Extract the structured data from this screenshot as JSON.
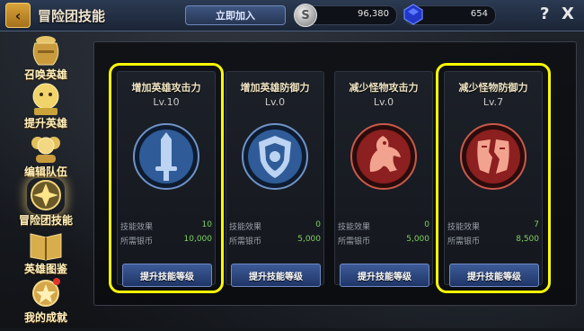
{
  "header": {
    "title": "冒险团技能",
    "back_icon": "back-icon",
    "join_label": "立即加入",
    "silver": "96,380",
    "gems": "654",
    "help": "?",
    "close": "X",
    "silver_icon_glyph": "S"
  },
  "sidebar": {
    "items": [
      {
        "label": "召唤英雄",
        "icon": "jar-icon"
      },
      {
        "label": "提升英雄",
        "icon": "levelup-icon"
      },
      {
        "label": "编辑队伍",
        "icon": "team-icon"
      },
      {
        "label": "冒险团技能",
        "icon": "skill-icon",
        "active": true
      },
      {
        "label": "英雄图鉴",
        "icon": "book-icon"
      },
      {
        "label": "我的成就",
        "icon": "medal-icon"
      }
    ]
  },
  "cards": [
    {
      "title": "增加英雄攻击力",
      "level": "Lv.10",
      "emblem": "sword-icon",
      "color": "#2f5c98",
      "effect_label": "技能效果",
      "effect": "10",
      "cost_label": "所需银币",
      "cost": "10,000",
      "button": "提升技能等级",
      "highlighted": true
    },
    {
      "title": "增加英雄防御力",
      "level": "Lv.0",
      "emblem": "shield-icon",
      "color": "#2f5c98",
      "effect_label": "技能效果",
      "effect": "0",
      "cost_label": "所需银币",
      "cost": "5,000",
      "button": "提升技能等级",
      "highlighted": false
    },
    {
      "title": "减少怪物攻击力",
      "level": "Lv.0",
      "emblem": "dragon-icon",
      "color": "#8c1f1f",
      "effect_label": "技能效果",
      "effect": "0",
      "cost_label": "所需银币",
      "cost": "5,000",
      "button": "提升技能等级",
      "highlighted": false
    },
    {
      "title": "减少怪物防御力",
      "level": "Lv.7",
      "emblem": "broken-shield-icon",
      "color": "#8c1f1f",
      "effect_label": "技能效果",
      "effect": "7",
      "cost_label": "所需银币",
      "cost": "8,500",
      "button": "提升技能等级",
      "highlighted": true
    }
  ]
}
